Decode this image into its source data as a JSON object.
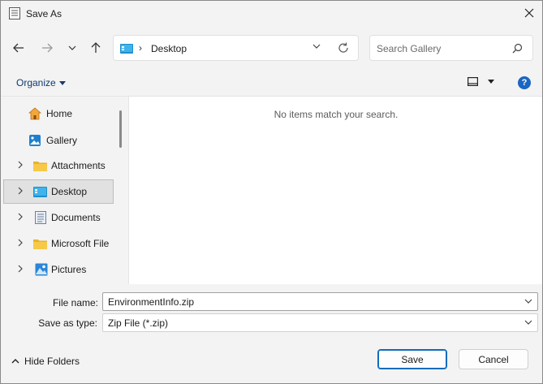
{
  "window": {
    "title": "Save As"
  },
  "address": {
    "location": "Desktop"
  },
  "search": {
    "placeholder": "Search Gallery"
  },
  "command_bar": {
    "organize_label": "Organize",
    "help_label": "?"
  },
  "nav_pane": {
    "items": [
      {
        "label": "Home",
        "icon": "home-icon",
        "expandable": false,
        "selected": false
      },
      {
        "label": "Gallery",
        "icon": "gallery-icon",
        "expandable": false,
        "selected": false
      },
      {
        "label": "Attachments",
        "icon": "folder-icon",
        "expandable": true,
        "selected": false
      },
      {
        "label": "Desktop",
        "icon": "desktop-icon",
        "expandable": true,
        "selected": true
      },
      {
        "label": "Documents",
        "icon": "documents-icon",
        "expandable": true,
        "selected": false
      },
      {
        "label": "Microsoft File",
        "icon": "folder-icon",
        "expandable": true,
        "selected": false
      },
      {
        "label": "Pictures",
        "icon": "pictures-icon",
        "expandable": true,
        "selected": false
      }
    ]
  },
  "content": {
    "empty_message": "No items match your search."
  },
  "form": {
    "file_name_label": "File name:",
    "file_name_value": "EnvironmentInfo.zip",
    "save_type_label": "Save as type:",
    "save_type_value": "Zip File (*.zip)"
  },
  "footer": {
    "hide_folders_label": "Hide Folders",
    "save_label": "Save",
    "cancel_label": "Cancel"
  },
  "colors": {
    "accent": "#0f6cbd",
    "folder": "#f5c542",
    "help": "#1a66c2"
  }
}
